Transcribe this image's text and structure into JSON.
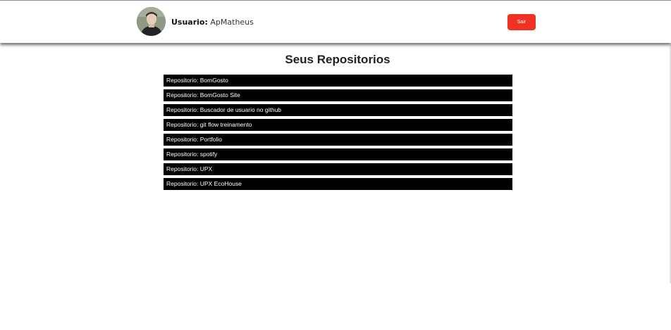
{
  "header": {
    "user_label": "Usuario:",
    "username": "ApMatheus",
    "logout_label": "Sair"
  },
  "main": {
    "title": "Seus Repositorios",
    "repo_prefix": "Repositorio:",
    "repositories": [
      "BomGosto",
      "BomGosto Site",
      "Buscador de usuario no github",
      "git flow treinamento",
      "Portfolio",
      "spotify",
      "UPX",
      "UPX EcoHouse"
    ]
  },
  "colors": {
    "logout_button": "#f03224",
    "repo_background": "#000000",
    "repo_text": "#ffffff"
  },
  "icons": {
    "avatar": "user-avatar-photo"
  }
}
